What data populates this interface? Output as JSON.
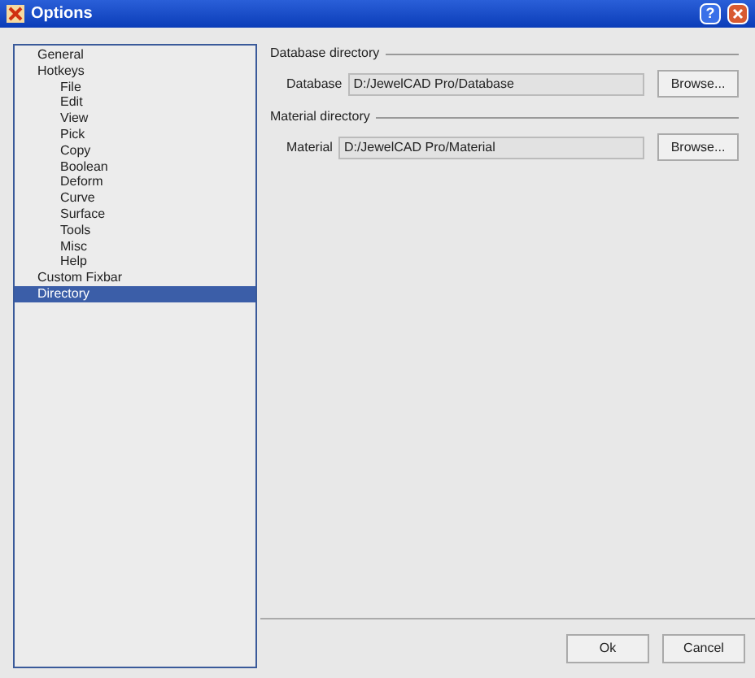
{
  "window": {
    "title": "Options",
    "help_button": "?"
  },
  "tree": [
    {
      "label": "General",
      "selected": false
    },
    {
      "label": "Hotkeys",
      "selected": false,
      "children": [
        {
          "label": "File",
          "selected": false
        },
        {
          "label": "Edit",
          "selected": false
        },
        {
          "label": "View",
          "selected": false
        },
        {
          "label": "Pick",
          "selected": false
        },
        {
          "label": "Copy",
          "selected": false
        },
        {
          "label": "Boolean",
          "selected": false
        },
        {
          "label": "Deform",
          "selected": false
        },
        {
          "label": "Curve",
          "selected": false
        },
        {
          "label": "Surface",
          "selected": false
        },
        {
          "label": "Tools",
          "selected": false
        },
        {
          "label": "Misc",
          "selected": false
        },
        {
          "label": "Help",
          "selected": false
        }
      ]
    },
    {
      "label": "Custom Fixbar",
      "selected": false
    },
    {
      "label": "Directory",
      "selected": true
    }
  ],
  "groups": [
    {
      "title": "Database directory",
      "label": "Database",
      "value": "D:/JewelCAD Pro/Database",
      "button": "Browse..."
    },
    {
      "title": "Material directory",
      "label": "Material",
      "value": "D:/JewelCAD Pro/Material",
      "button": "Browse..."
    }
  ],
  "buttons": [
    "Ok",
    "Cancel"
  ]
}
